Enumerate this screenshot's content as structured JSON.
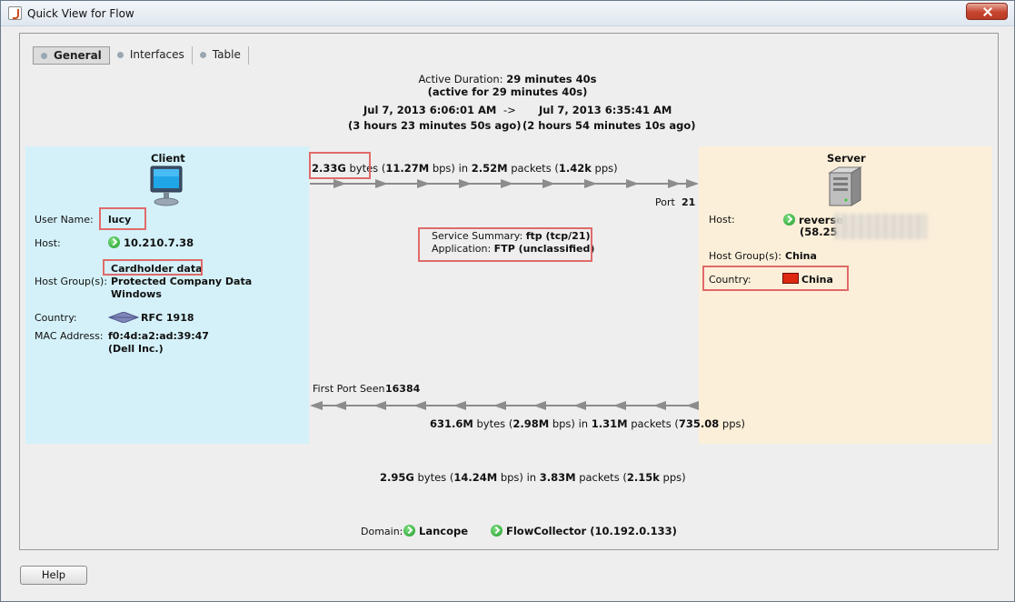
{
  "window": {
    "title": "Quick View for Flow"
  },
  "tabs": [
    {
      "label": "General"
    },
    {
      "label": "Interfaces"
    },
    {
      "label": "Table"
    }
  ],
  "duration": {
    "label": "Active Duration:",
    "value": "29 minutes 40s",
    "active_note": "(active for 29 minutes 40s)",
    "start_time": "Jul 7, 2013 6:06:01 AM",
    "arrow": "->",
    "end_time": "Jul 7, 2013 6:35:41 AM",
    "start_ago": "(3 hours 23 minutes 50s ago)",
    "end_ago": "(2 hours 54 minutes 10s ago)"
  },
  "client": {
    "heading": "Client",
    "user_name_label": "User Name:",
    "user_name": "lucy",
    "host_label": "Host:",
    "host": "10.210.7.38",
    "host_group_label": "Host Group(s):",
    "host_groups": [
      "Cardholder data",
      "Protected Company Data",
      "Windows"
    ],
    "country_label": "Country:",
    "country": "RFC 1918",
    "mac_label": "MAC Address:",
    "mac": "f0:4d:a2:ad:39:47",
    "mac_vendor": "(Dell Inc.)"
  },
  "server": {
    "heading": "Server",
    "host_label": "Host:",
    "host": "reverse",
    "host_ip_partial": "(58.25",
    "host_group_label": "Host Group(s):",
    "host_group": "China",
    "country_label": "Country:",
    "country": "China"
  },
  "traffic_out": {
    "bytes": "2.33G",
    "bytes_unit": "bytes",
    "rate": "11.27M",
    "rate_unit": "bps",
    "in_word": "in",
    "packets": "2.52M",
    "packets_unit": "packets",
    "pps": "1.42k",
    "pps_unit": "pps",
    "port_label": "Port",
    "port": "21"
  },
  "traffic_in": {
    "first_port_label": "First Port Seen",
    "first_port": "16384",
    "bytes": "631.6M",
    "bytes_unit": "bytes",
    "rate": "2.98M",
    "rate_unit": "bps",
    "in_word": "in",
    "packets": "1.31M",
    "packets_unit": "packets",
    "pps": "735.08",
    "pps_unit": "pps"
  },
  "service": {
    "summary_label": "Service Summary:",
    "summary": "ftp (tcp/21)",
    "app_label": "Application:",
    "app": "FTP (unclassified)"
  },
  "total": {
    "bytes": "2.95G",
    "bytes_unit": "bytes",
    "rate": "14.24M",
    "rate_unit": "bps",
    "in_word": "in",
    "packets": "3.83M",
    "packets_unit": "packets",
    "pps": "2.15k",
    "pps_unit": "pps"
  },
  "domain": {
    "label": "Domain:",
    "name": "Lancope",
    "collector": "FlowCollector (10.192.0.133)"
  },
  "buttons": {
    "help": "Help"
  },
  "colors": {
    "client_bg": "#d4f1f9",
    "server_bg": "#fcefd9",
    "highlight_box": "#e06a6a",
    "arrow": "#8c8c8c"
  }
}
